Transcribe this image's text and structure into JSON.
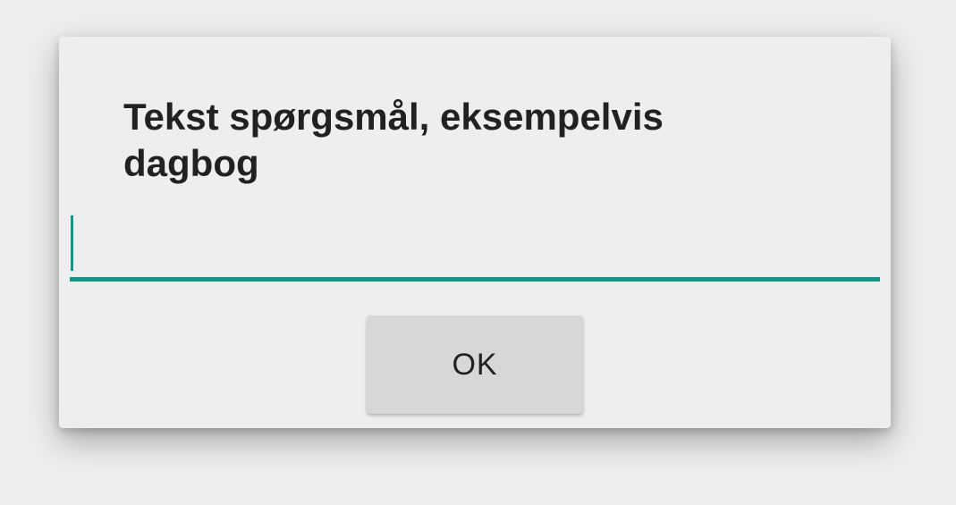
{
  "dialog": {
    "title": "Tekst spørgsmål, eksempelvis dagbog",
    "input": {
      "value": "",
      "placeholder": ""
    },
    "ok_label": "OK"
  },
  "colors": {
    "accent": "#129688",
    "background": "#eeeeee",
    "button_bg": "#d6d7d7",
    "text": "#212121"
  }
}
